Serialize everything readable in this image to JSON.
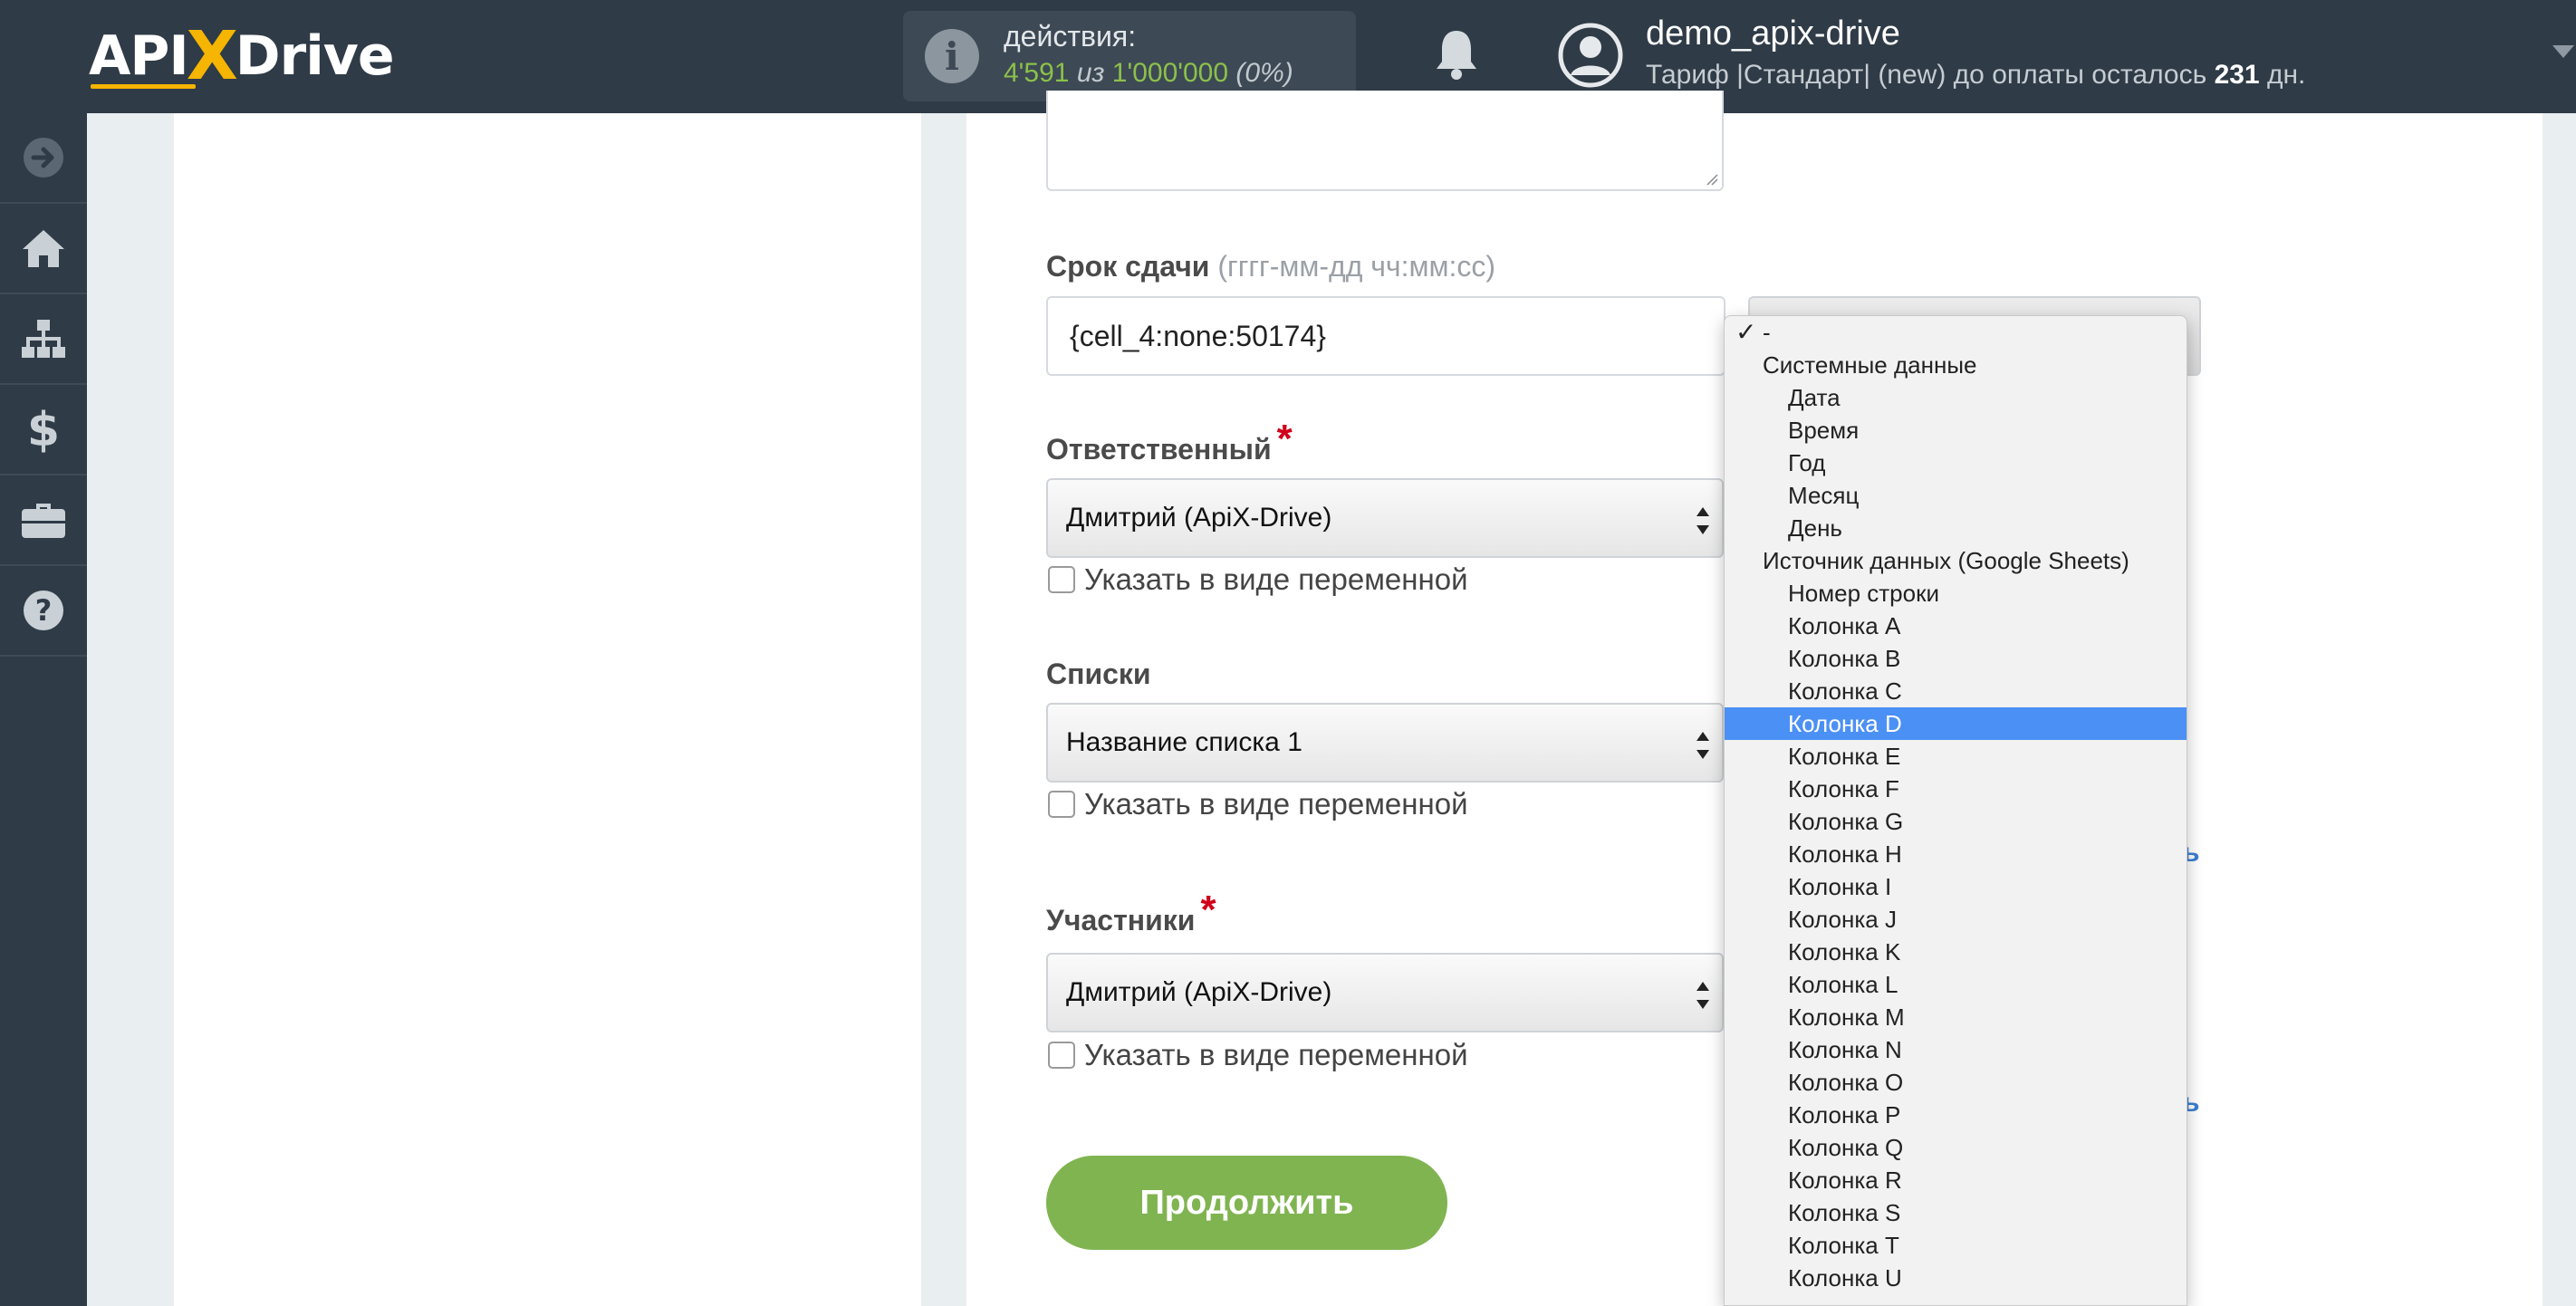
{
  "header": {
    "logo": {
      "part1": "API",
      "x": "X",
      "part2": "Drive"
    },
    "actions": {
      "label": "действия:",
      "used": "4'591",
      "of": "из",
      "total": "1'000'000",
      "percent": "(0%)"
    },
    "user": {
      "name": "demo_apix-drive",
      "tariff_prefix": "Тариф |Стандарт| (new) до оплаты осталось",
      "days": "231",
      "days_suffix": "дн."
    }
  },
  "sidebar": {
    "items": [
      {
        "icon": "arrow-right-circle-icon"
      },
      {
        "icon": "home-icon"
      },
      {
        "icon": "sitemap-icon"
      },
      {
        "icon": "dollar-icon"
      },
      {
        "icon": "briefcase-icon"
      },
      {
        "icon": "help-circle-icon"
      }
    ]
  },
  "form": {
    "due_date": {
      "label": "Срок сдачи",
      "hint": "(гггг-мм-дд чч:мм:сс)",
      "value": "{cell_4:none:50174}"
    },
    "responsible": {
      "label": "Ответственный",
      "required_mark": "*",
      "value": "Дмитрий (ApiX-Drive)",
      "checkbox_label": "Указать в виде переменной"
    },
    "lists": {
      "label": "Списки",
      "value": "Название списка 1",
      "checkbox_label": "Указать в виде переменной"
    },
    "participants": {
      "label": "Участники",
      "required_mark": "*",
      "value": "Дмитрий (ApiX-Drive)",
      "checkbox_label": "Указать в виде переменной"
    },
    "continue_label": "Продолжить",
    "partial_link_1": "ь",
    "partial_link_2": "ь"
  },
  "dropdown": {
    "checked_mark": "✓",
    "options": [
      {
        "label": "-",
        "type": "first",
        "checked": true
      },
      {
        "label": "Системные данные",
        "type": "group"
      },
      {
        "label": "Дата",
        "type": "child"
      },
      {
        "label": "Время",
        "type": "child"
      },
      {
        "label": "Год",
        "type": "child"
      },
      {
        "label": "Месяц",
        "type": "child"
      },
      {
        "label": "День",
        "type": "child"
      },
      {
        "label": "Источник данных (Google Sheets)",
        "type": "group"
      },
      {
        "label": "Номер строки",
        "type": "child"
      },
      {
        "label": "Колонка A",
        "type": "child"
      },
      {
        "label": "Колонка B",
        "type": "child"
      },
      {
        "label": "Колонка C",
        "type": "child"
      },
      {
        "label": "Колонка D",
        "type": "child",
        "selected": true
      },
      {
        "label": "Колонка E",
        "type": "child"
      },
      {
        "label": "Колонка F",
        "type": "child"
      },
      {
        "label": "Колонка G",
        "type": "child"
      },
      {
        "label": "Колонка H",
        "type": "child"
      },
      {
        "label": "Колонка I",
        "type": "child"
      },
      {
        "label": "Колонка J",
        "type": "child"
      },
      {
        "label": "Колонка K",
        "type": "child"
      },
      {
        "label": "Колонка L",
        "type": "child"
      },
      {
        "label": "Колонка M",
        "type": "child"
      },
      {
        "label": "Колонка N",
        "type": "child"
      },
      {
        "label": "Колонка O",
        "type": "child"
      },
      {
        "label": "Колонка P",
        "type": "child"
      },
      {
        "label": "Колонка Q",
        "type": "child"
      },
      {
        "label": "Колонка R",
        "type": "child"
      },
      {
        "label": "Колонка S",
        "type": "child"
      },
      {
        "label": "Колонка T",
        "type": "child"
      },
      {
        "label": "Колонка U",
        "type": "child"
      }
    ]
  },
  "colors": {
    "header_bg": "#2f3b47",
    "accent_green": "#80b451",
    "counter_green": "#8cc04b",
    "selected_blue": "#4b90f5",
    "required_red": "#d0021b"
  }
}
